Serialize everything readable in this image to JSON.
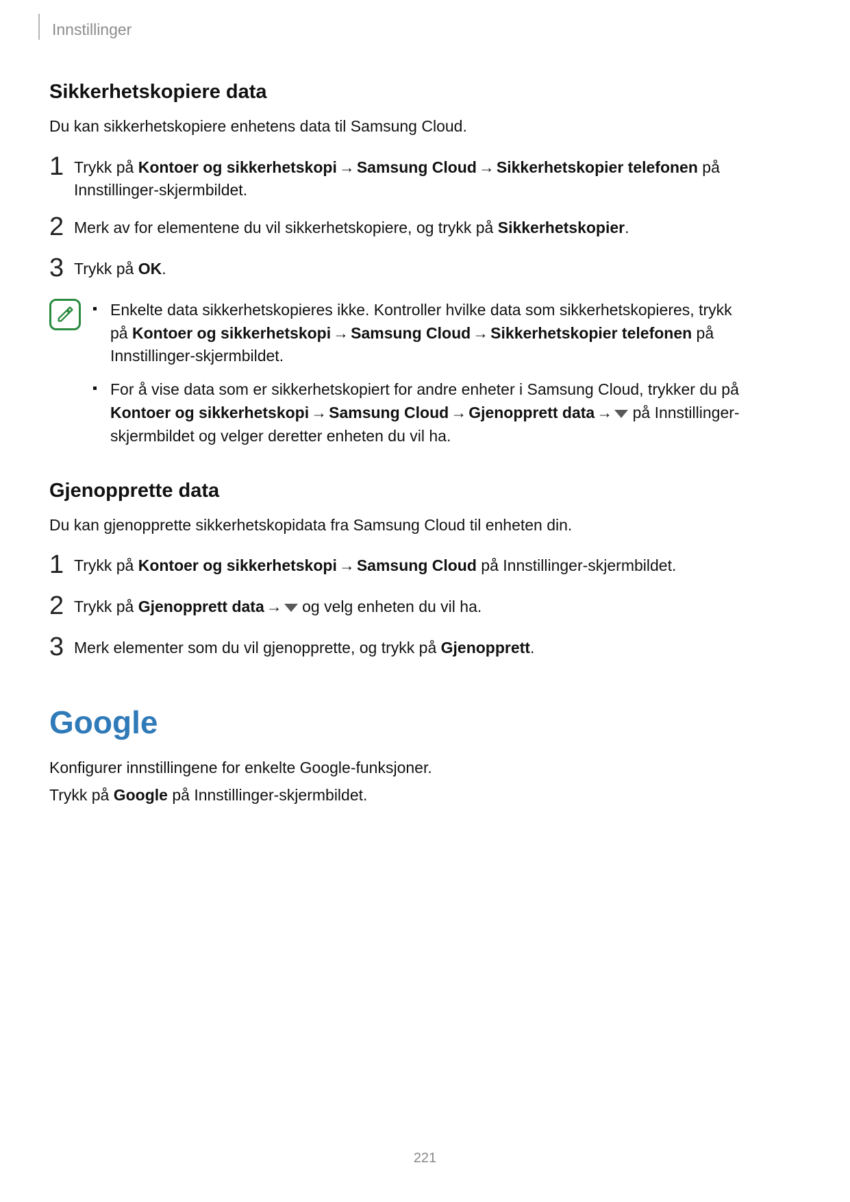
{
  "header": {
    "breadcrumb": "Innstillinger"
  },
  "section_backup": {
    "heading": "Sikkerhetskopiere data",
    "intro": "Du kan sikkerhetskopiere enhetens data til Samsung Cloud.",
    "step1": {
      "num": "1",
      "pre": "Trykk på ",
      "b1": "Kontoer og sikkerhetskopi",
      "arr1": " → ",
      "b2": "Samsung Cloud",
      "arr2": " → ",
      "b3": "Sikkerhetskopier telefonen",
      "post": " på Innstillinger-skjermbildet."
    },
    "step2": {
      "num": "2",
      "pre": "Merk av for elementene du vil sikkerhetskopiere, og trykk på ",
      "b1": "Sikkerhetskopier",
      "post": "."
    },
    "step3": {
      "num": "3",
      "pre": "Trykk på ",
      "b1": "OK",
      "post": "."
    }
  },
  "note": {
    "bullet1": {
      "pre": "Enkelte data sikkerhetskopieres ikke. Kontroller hvilke data som sikkerhetskopieres, trykk på ",
      "b1": "Kontoer og sikkerhetskopi",
      "arr1": " → ",
      "b2": "Samsung Cloud",
      "arr2": " → ",
      "b3": "Sikkerhetskopier telefonen",
      "post": " på Innstillinger-skjermbildet."
    },
    "bullet2": {
      "pre": "For å vise data som er sikkerhetskopiert for andre enheter i Samsung Cloud, trykker du på ",
      "b1": "Kontoer og sikkerhetskopi",
      "arr1": " → ",
      "b2": "Samsung Cloud",
      "arr2": " → ",
      "b3": "Gjenopprett data",
      "arr3": " → ",
      "post": " på Innstillinger-skjermbildet og velger deretter enheten du vil ha."
    }
  },
  "section_restore": {
    "heading": "Gjenopprette data",
    "intro": "Du kan gjenopprette sikkerhetskopidata fra Samsung Cloud til enheten din.",
    "step1": {
      "num": "1",
      "pre": "Trykk på ",
      "b1": "Kontoer og sikkerhetskopi",
      "arr1": " → ",
      "b2": "Samsung Cloud",
      "post": " på Innstillinger-skjermbildet."
    },
    "step2": {
      "num": "2",
      "pre": "Trykk på ",
      "b1": "Gjenopprett data",
      "arr1": " → ",
      "post": " og velg enheten du vil ha."
    },
    "step3": {
      "num": "3",
      "pre": "Merk elementer som du vil gjenopprette, og trykk på ",
      "b1": "Gjenopprett",
      "post": "."
    }
  },
  "section_google": {
    "heading": "Google",
    "line1": "Konfigurer innstillingene for enkelte Google-funksjoner.",
    "line2_pre": "Trykk på ",
    "line2_b": "Google",
    "line2_post": " på Innstillinger-skjermbildet."
  },
  "page_number": "221"
}
